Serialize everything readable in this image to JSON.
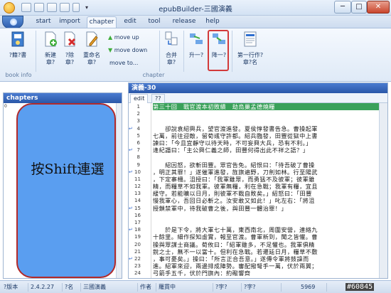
{
  "window": {
    "title": "epubBuilder-三國演義",
    "min_label": "─",
    "max_label": "□",
    "close_label": "✕"
  },
  "tabs": [
    {
      "label": "start"
    },
    {
      "label": "import"
    },
    {
      "label": "chapter"
    },
    {
      "label": "edit"
    },
    {
      "label": "tool"
    },
    {
      "label": "release"
    },
    {
      "label": "help"
    }
  ],
  "ribbon": {
    "book_info_btn": "?籍?書",
    "book_info_group": "book info",
    "new_chapter": "新建\n章?",
    "delete_chapter": "?除\n章?",
    "rename_chapter": "重命名\n章?",
    "move_up": "move up",
    "move_down": "move down",
    "move_to": "move to...",
    "merge": "合并\n章?",
    "promote": "升一?",
    "demote": "降一?",
    "first_line_title": "第一行作?\n章?名",
    "chapter_group": "chapter"
  },
  "left_panel": {
    "header": "chapters",
    "line_start": "0",
    "overlay_text": "按Shift連選"
  },
  "right_panel": {
    "header": "演義-30",
    "tabs": [
      "edit",
      "??"
    ]
  },
  "editor_lines": [
    {
      "n": "1",
      "mark": "",
      "text": "第三十回　戰官渡本初敗績　劫烏巢孟德燒糧",
      "style": "title"
    },
    {
      "n": "2",
      "mark": "",
      "text": ""
    },
    {
      "n": "3",
      "mark": "",
      "text": ""
    },
    {
      "n": "4",
      "mark": "↵",
      "text": "　　卻說袁紹興兵，望官渡進發。夏侯惇發書告急。曹操起軍"
    },
    {
      "n": "5",
      "mark": "",
      "text": "七萬，前往迎敵，留荀彧守許都。紹兵臨發，田豐從獄中上書"
    },
    {
      "n": "6",
      "mark": "",
      "text": "諫曰：「今且宜靜守以待天時，不可妄興大兵，恐有不利。」"
    },
    {
      "n": "7",
      "mark": "↵",
      "text": "逢紀譖曰：「主公興仁義之師，田豐何得出此不祥之語？」"
    },
    {
      "n": "8",
      "mark": "",
      "text": ""
    },
    {
      "n": "9",
      "mark": "",
      "text": "　　紹因怒，欲斬田豐。眾官告免。紹恨曰：「待吾破了曹操"
    },
    {
      "n": "10",
      "mark": "↵",
      "text": "，明正其罪！」遂催軍進發，旌旗遍野，刀劍如林。行至陽武"
    },
    {
      "n": "11",
      "mark": "",
      "text": "，下定寨柵。沮授曰：「我軍雖眾，而勇猛不及彼軍；彼軍雖"
    },
    {
      "n": "12",
      "mark": "",
      "text": "精，而糧草不如我軍。彼軍無糧，利在急戰；我軍有糧，宜且"
    },
    {
      "n": "13",
      "mark": "",
      "text": "緩守。若能曠以日月，則彼軍不戰自敗矣。」紹怒曰：「田豐"
    },
    {
      "n": "14",
      "mark": "",
      "text": "慢我軍心，吾回日必斬之。汝安敢又如此！」叱左右：「將沮"
    },
    {
      "n": "15",
      "mark": "↵",
      "text": "授鎖禁軍中，待我破曹之後，與田豐一體治罪！」"
    },
    {
      "n": "16",
      "mark": "",
      "text": ""
    },
    {
      "n": "17",
      "mark": "",
      "text": ""
    },
    {
      "n": "18",
      "mark": "↵",
      "text": "　　於是下令，將大軍七十萬，東西南北，周圍安營，連絡九"
    },
    {
      "n": "19",
      "mark": "",
      "text": "十餘里。細作探知虛實，報至官渡。曹軍新到，聞之皆懼。曹"
    },
    {
      "n": "20",
      "mark": "",
      "text": "操與眾謀士商議。荀攸曰：「紹軍雖多，不足懼也。我軍俱精"
    },
    {
      "n": "21",
      "mark": "",
      "text": "銳之士，無不一以當十。但利在急戰。若遷延日月，糧草不敷"
    },
    {
      "n": "22",
      "mark": "↵",
      "text": "，事可憂矣。」操曰：「所言正合吾意。」遂傳令軍將鼓譟而"
    },
    {
      "n": "23",
      "mark": "",
      "text": "進。紹軍來迎，兩邊排成陣勢。審配撥弩手一萬，伏於兩翼；"
    },
    {
      "n": "24",
      "mark": "",
      "text": "弓箭手五千，伏於門旗內：約礮響齊"
    }
  ],
  "status": {
    "f1": "?版本",
    "f2": "2.4.2.27",
    "f3": "?名",
    "f4": "三國演義",
    "f5": "作者",
    "f6": "羅貫中",
    "f7": "?字?",
    "f8": "?字?",
    "f9": "5969"
  },
  "watermark": "#60845"
}
